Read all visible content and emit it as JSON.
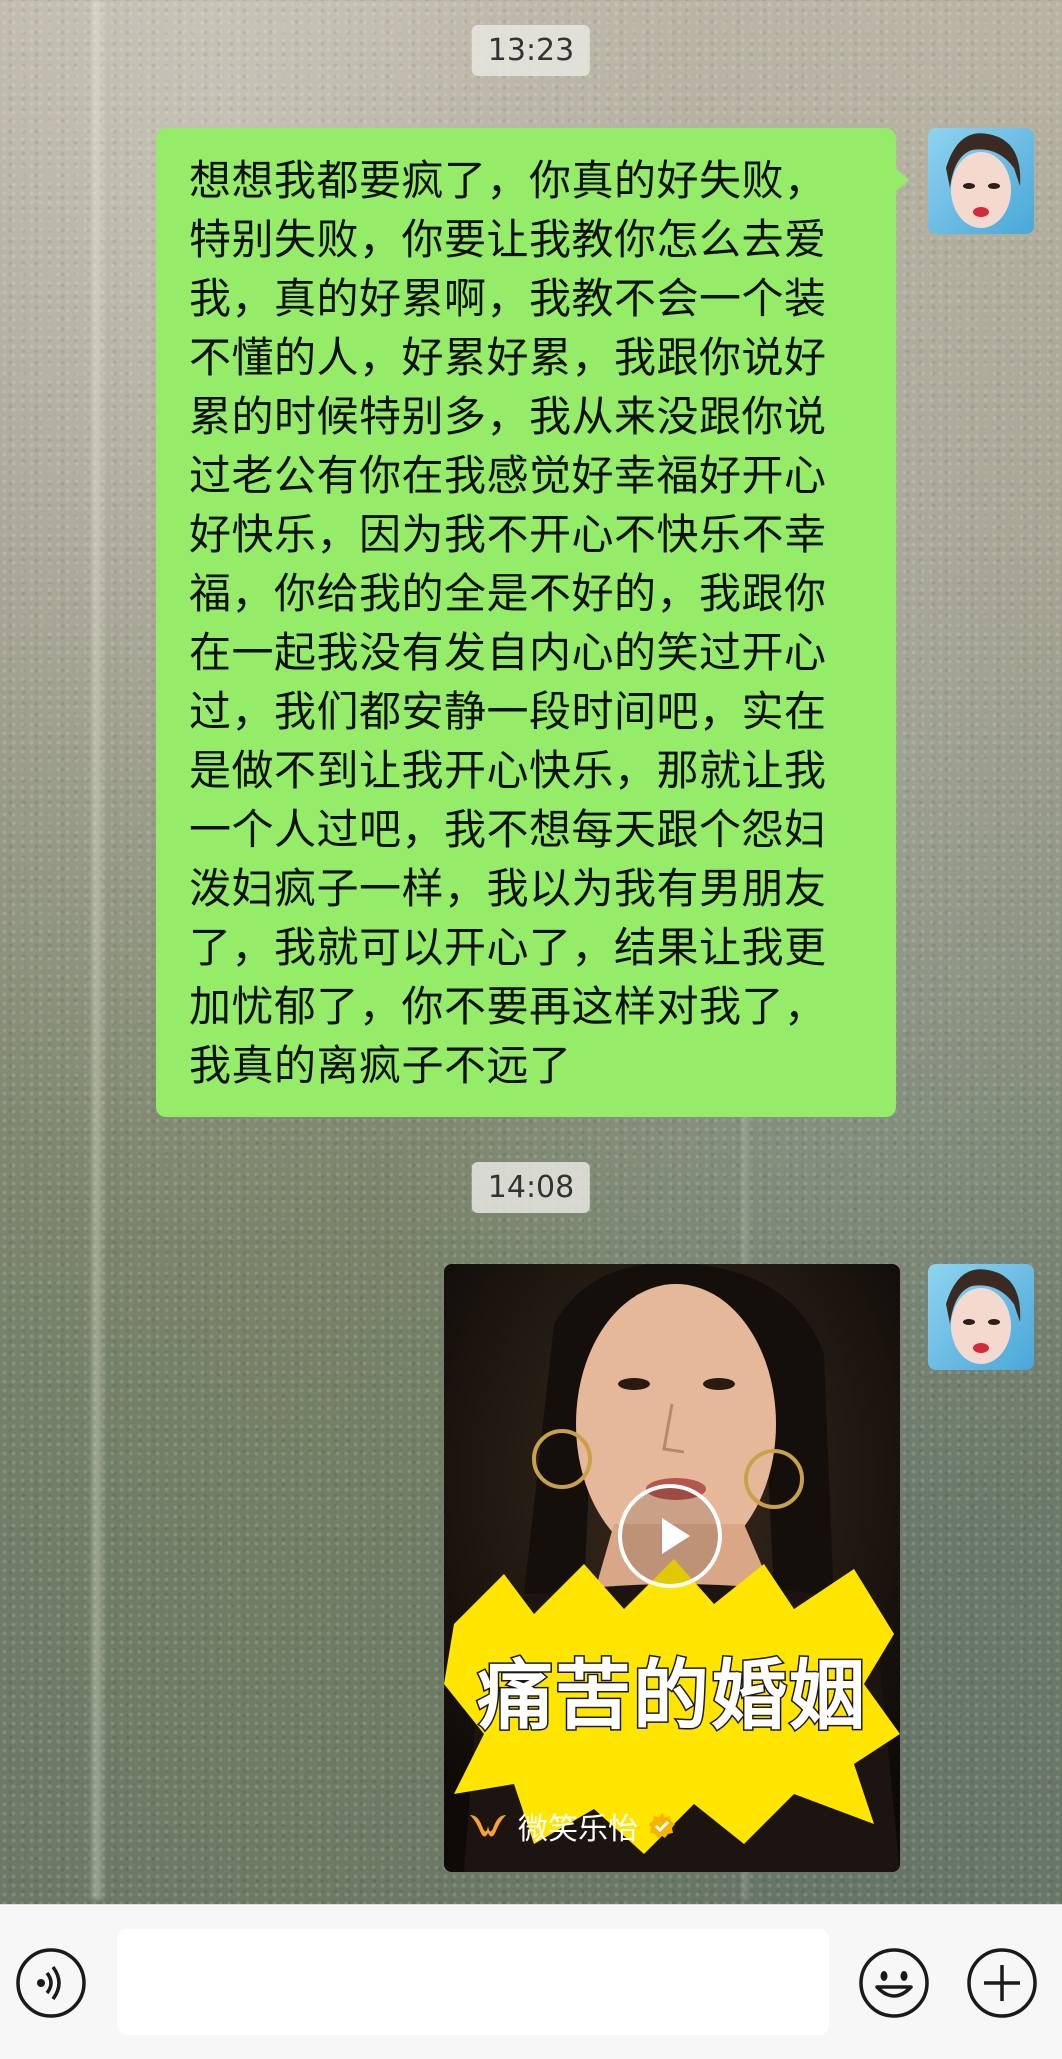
{
  "chat": {
    "messages": [
      {
        "timestamp": "13:23",
        "type": "text",
        "sender": "me",
        "text": "想想我都要疯了，你真的好失败，特别失败，你要让我教你怎么去爱我，真的好累啊，我教不会一个装不懂的人，好累好累，我跟你说好累的时候特别多，我从来没跟你说过老公有你在我感觉好幸福好开心好快乐，因为我不开心不快乐不幸福，你给我的全是不好的，我跟你在一起我没有发自内心的笑过开心过，我们都安静一段时间吧，实在是做不到让我开心快乐，那就让我一个人过吧，我不想每天跟个怨妇泼妇疯子一样，我以为我有男朋友了，我就可以开心了，结果让我更加忧郁了，你不要再这样对我了，我真的离疯子不远了"
      },
      {
        "timestamp": "14:08",
        "type": "video",
        "sender": "me",
        "video_title": "痛苦的婚姻",
        "source_name": "微笑乐怡"
      }
    ]
  },
  "icons": {
    "voice": "voice-icon",
    "emoji": "emoji-icon",
    "more": "plus-icon",
    "play": "play-icon",
    "verified": "verified-badge-icon",
    "channel_logo": "channels-logo-icon"
  },
  "colors": {
    "bubble_me": "#95ec69",
    "input_bar": "#f7f7f7",
    "title_highlight": "#ffe500"
  },
  "input": {
    "value": ""
  }
}
